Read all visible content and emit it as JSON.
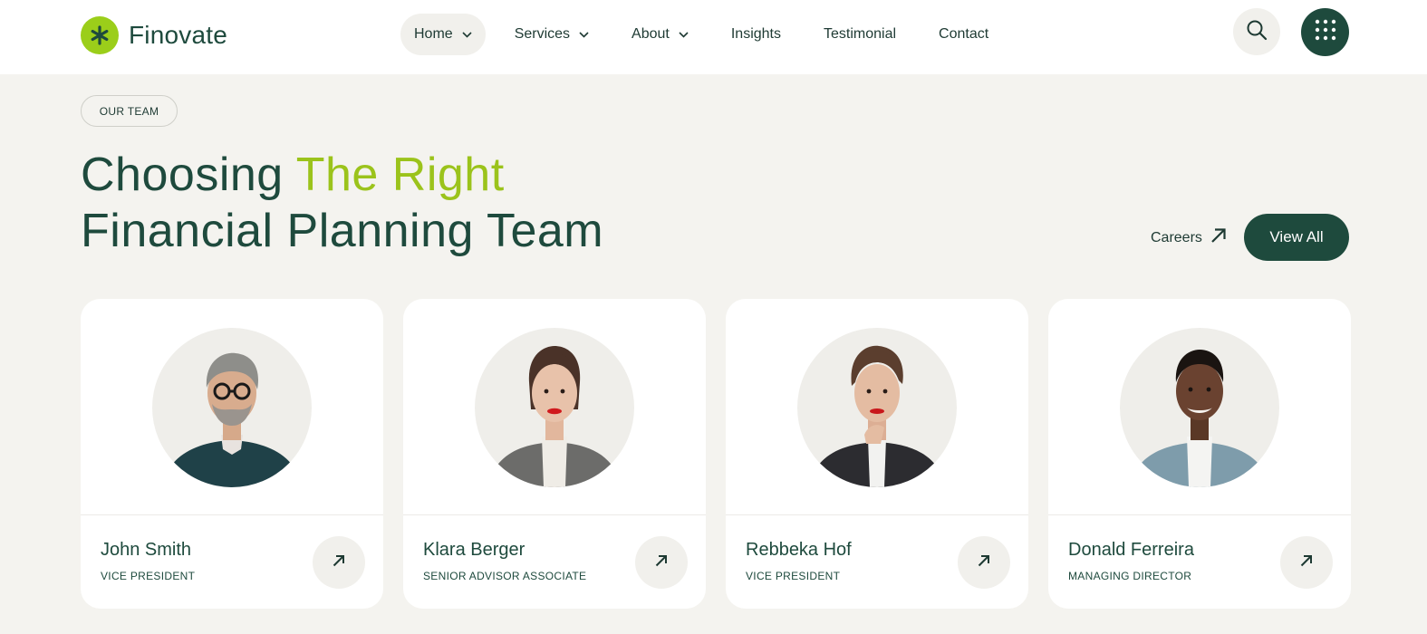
{
  "brand": {
    "name": "Finovate",
    "accent": "#9bce1a",
    "primary": "#1e4a3d"
  },
  "nav": {
    "items": [
      {
        "label": "Home",
        "has_dropdown": true,
        "active": true
      },
      {
        "label": "Services",
        "has_dropdown": true,
        "active": false
      },
      {
        "label": "About",
        "has_dropdown": true,
        "active": false
      },
      {
        "label": "Insights",
        "has_dropdown": false,
        "active": false
      },
      {
        "label": "Testimonial",
        "has_dropdown": false,
        "active": false
      },
      {
        "label": "Contact",
        "has_dropdown": false,
        "active": false
      }
    ],
    "search_icon": "search-icon",
    "menu_icon": "grid-dots-icon"
  },
  "section": {
    "eyebrow": "OUR TEAM",
    "title_part1": "Choosing ",
    "title_accent": "The Right",
    "title_part2": "Financial Planning Team",
    "careers_label": "Careers",
    "view_all_label": "View All"
  },
  "team": [
    {
      "name": "John Smith",
      "role": "VICE PRESIDENT"
    },
    {
      "name": "Klara Berger",
      "role": "SENIOR ADVISOR ASSOCIATE"
    },
    {
      "name": "Rebbeka Hof",
      "role": "VICE PRESIDENT"
    },
    {
      "name": "Donald Ferreira",
      "role": "MANAGING DIRECTOR"
    }
  ]
}
